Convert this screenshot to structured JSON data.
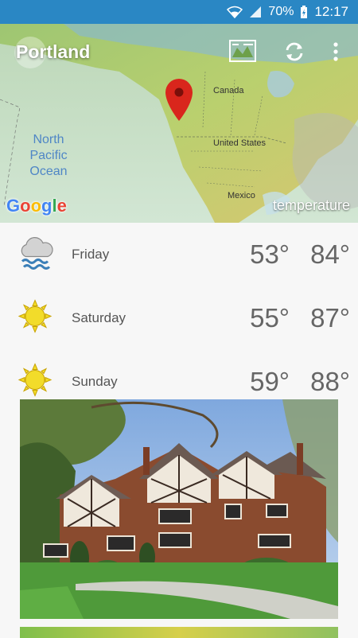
{
  "status_bar": {
    "battery": "70%",
    "time": "12:17"
  },
  "header": {
    "city": "Portland",
    "layer_label": "temperature",
    "map_labels": {
      "canada": "Canada",
      "united_states": "United States",
      "mexico": "Mexico",
      "ocean": "North Pacific Ocean"
    },
    "google": [
      "G",
      "o",
      "o",
      "g",
      "l",
      "e"
    ]
  },
  "forecast": [
    {
      "day": "Friday",
      "low": "53°",
      "high": "84°",
      "icon": "rain-cloud-icon"
    },
    {
      "day": "Saturday",
      "low": "55°",
      "high": "87°",
      "icon": "sun-icon"
    },
    {
      "day": "Sunday",
      "low": "59°",
      "high": "88°",
      "icon": "sun-icon"
    }
  ],
  "colors": {
    "status_bar": "#2a87c4",
    "pin": "#d9261c",
    "sun": "#f2dc2a"
  }
}
